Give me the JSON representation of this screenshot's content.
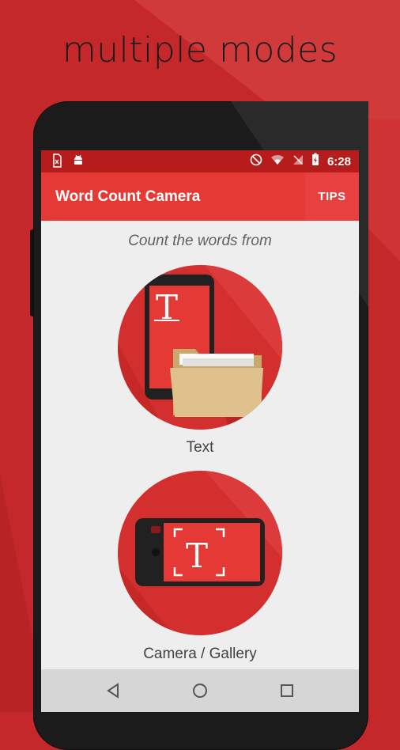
{
  "headline": "multiple modes",
  "status_bar": {
    "time": "6:28",
    "left_icons": [
      "sd-card-icon",
      "android-icon"
    ],
    "right_icons": [
      "do-not-disturb-icon",
      "wifi-icon",
      "no-signal-icon",
      "battery-charging-icon"
    ]
  },
  "app_bar": {
    "title": "Word Count Camera",
    "action_label": "TIPS"
  },
  "main": {
    "subtitle": "Count the words from",
    "modes": [
      {
        "label": "Text",
        "icon": "text-document-icon"
      },
      {
        "label": "Camera / Gallery",
        "icon": "camera-capture-icon"
      }
    ]
  },
  "nav_bar": {
    "buttons": [
      "back-icon",
      "home-icon",
      "recents-icon"
    ]
  },
  "colors": {
    "background": "#c5282b",
    "status_bar": "#b71c1c",
    "app_bar": "#e53935",
    "accent": "#d32f2f",
    "folder": "#dfc18d"
  }
}
